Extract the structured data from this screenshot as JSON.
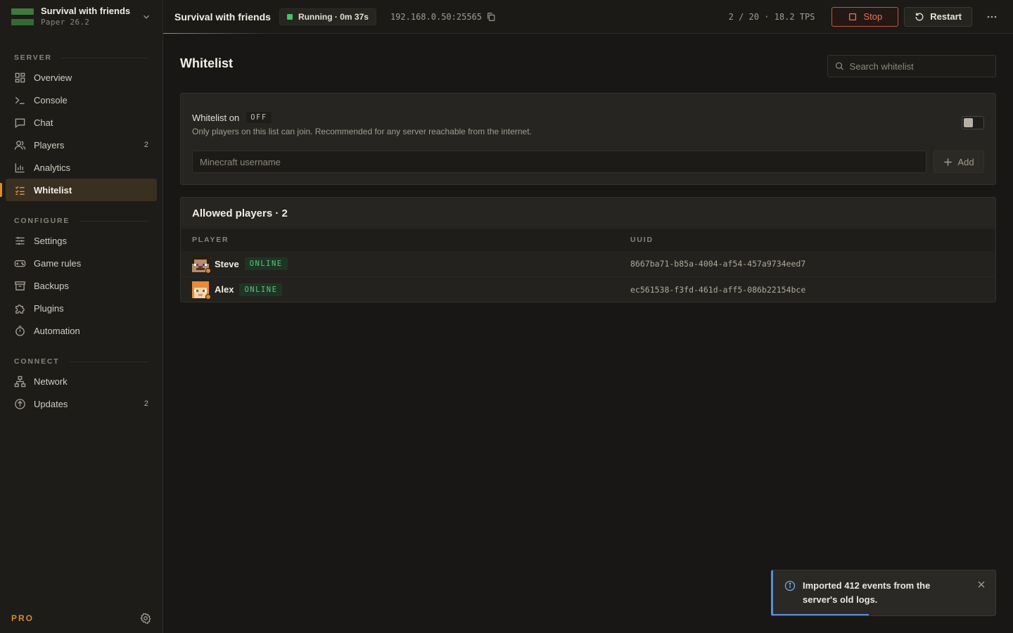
{
  "server": {
    "name": "Survival with friends",
    "version": "Paper 26.2"
  },
  "sidebar": {
    "sections": [
      {
        "label": "SERVER"
      },
      {
        "label": "CONFIGURE"
      },
      {
        "label": "CONNECT"
      }
    ],
    "items": [
      {
        "label": "Overview",
        "icon": "grid-icon"
      },
      {
        "label": "Console",
        "icon": "terminal-icon"
      },
      {
        "label": "Chat",
        "icon": "chat-icon"
      },
      {
        "label": "Players",
        "icon": "users-icon",
        "count": "2"
      },
      {
        "label": "Analytics",
        "icon": "bar-chart-icon"
      },
      {
        "label": "Whitelist",
        "icon": "list-check-icon",
        "active": true
      },
      {
        "label": "Settings",
        "icon": "sliders-icon"
      },
      {
        "label": "Game rules",
        "icon": "gamepad-icon"
      },
      {
        "label": "Backups",
        "icon": "archive-icon"
      },
      {
        "label": "Plugins",
        "icon": "puzzle-icon"
      },
      {
        "label": "Automation",
        "icon": "timer-icon"
      },
      {
        "label": "Network",
        "icon": "network-icon"
      },
      {
        "label": "Updates",
        "icon": "arrow-up-circle-icon",
        "count": "2"
      }
    ],
    "footer": {
      "plan": "PRO"
    }
  },
  "topbar": {
    "title": "Survival with friends",
    "status": "Running · 0m 37s",
    "status_color": "#46c36a",
    "address": "192.168.0.50:25565",
    "stats": "2 / 20 · 18.2 TPS",
    "stop_label": "Stop",
    "restart_label": "Restart"
  },
  "page": {
    "title": "Whitelist",
    "search_placeholder": "Search whitelist"
  },
  "whitelist": {
    "label": "Whitelist on",
    "state": "OFF",
    "enabled": false,
    "description": "Only players on this list can join. Recommended for any server reachable from the internet.",
    "input_placeholder": "Minecraft username",
    "add_label": "Add"
  },
  "allowed": {
    "title": "Allowed players · 2",
    "columns": [
      "PLAYER",
      "UUID"
    ],
    "rows": [
      {
        "name": "Steve",
        "status": "ONLINE",
        "uuid": "8667ba71-b85a-4004-af54-457a9734eed7"
      },
      {
        "name": "Alex",
        "status": "ONLINE",
        "uuid": "ec561538-f3fd-461d-aff5-086b22154bce"
      }
    ]
  },
  "toast": {
    "message": "Imported 412 events from the server's old logs.",
    "accent": "#5b8fd6",
    "progress": 0.43
  },
  "colors": {
    "accent": "#e08a2c",
    "danger": "#e8755b",
    "online": "#5bc477"
  }
}
